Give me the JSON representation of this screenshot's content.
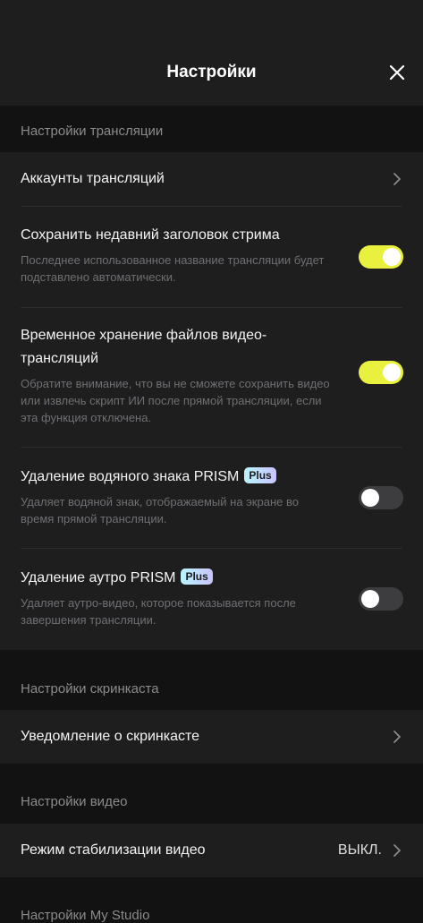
{
  "header": {
    "title": "Настройки"
  },
  "sections": {
    "broadcast": {
      "label": "Настройки трансляции",
      "items": {
        "accounts": {
          "title": "Аккаунты трансляций"
        },
        "save_title": {
          "title": "Сохранить недавний заголовок стрима",
          "description": "Последнее использованное название трансляции будет подставлено автоматически.",
          "enabled": true
        },
        "temp_storage": {
          "title": "Временное хранение файлов видео-трансляций",
          "description": "Обратите внимание, что вы не сможете сохранить видео или извлечь скрипт ИИ после прямой трансляции, если эта функция отключена.",
          "enabled": true
        },
        "watermark": {
          "title": "Удаление водяного знака PRISM",
          "badge": "Plus",
          "description": "Удаляет водяной знак, отображаемый на экране во время прямой трансляции.",
          "enabled": false
        },
        "outro": {
          "title": "Удаление аутро PRISM",
          "badge": "Plus",
          "description": "Удаляет аутро-видео, которое показывается после завершения трансляции.",
          "enabled": false
        }
      }
    },
    "screencast": {
      "label": "Настройки скринкаста",
      "items": {
        "notification": {
          "title": "Уведомление о скринкасте"
        }
      }
    },
    "video": {
      "label": "Настройки видео",
      "items": {
        "stabilization": {
          "title": "Режим стабилизации видео",
          "value": "ВЫКЛ."
        }
      }
    },
    "my_studio": {
      "label": "Настройки My Studio"
    }
  },
  "colors": {
    "toggle_on": "#eaf03e",
    "toggle_off": "#3d3d40",
    "background": "#121212",
    "card": "#1e1e1f"
  }
}
